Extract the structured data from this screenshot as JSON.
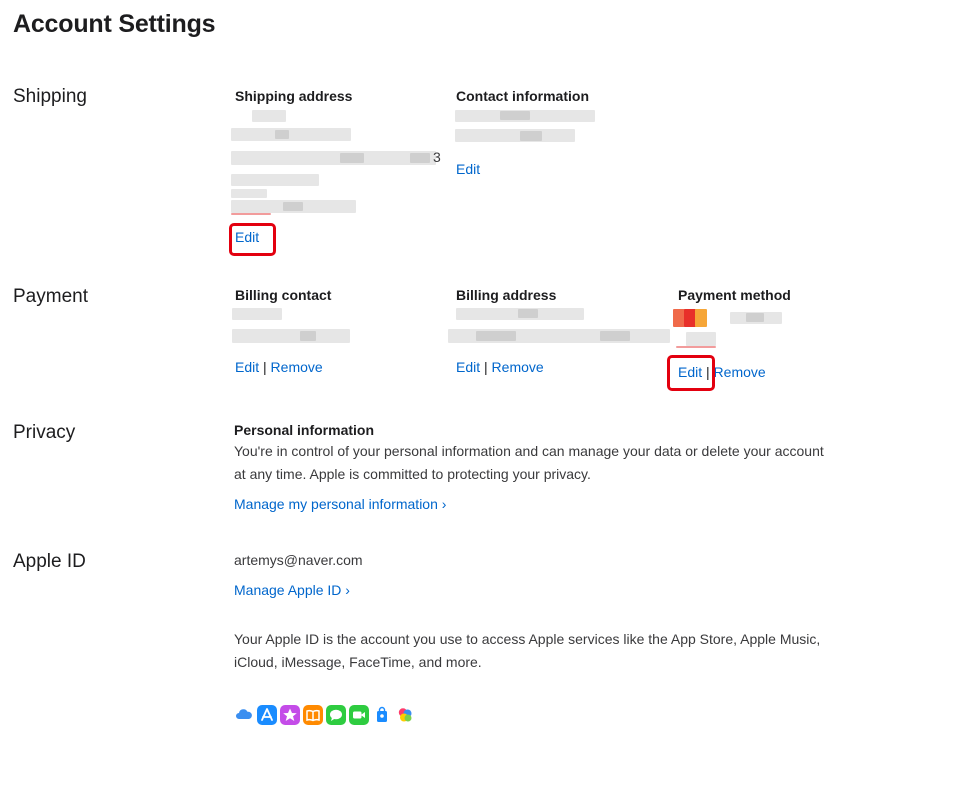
{
  "page_title": "Account Settings",
  "shipping": {
    "section": "Shipping",
    "address_title": "Shipping address",
    "address_trailing_digit": "3",
    "address_edit": "Edit",
    "contact_title": "Contact information",
    "contact_edit": "Edit"
  },
  "payment": {
    "section": "Payment",
    "billing_contact_title": "Billing contact",
    "billing_address_title": "Billing address",
    "payment_method_title": "Payment method",
    "edit": "Edit",
    "separator": "|",
    "remove": "Remove"
  },
  "privacy": {
    "section": "Privacy",
    "title": "Personal information",
    "line1": "You're in control of your personal information and can manage your data or delete your account",
    "line2": "at any time. Apple is committed to protecting your privacy.",
    "link": "Manage my personal information ›"
  },
  "apple_id": {
    "section": "Apple ID",
    "email": "artemys@naver.com",
    "link": "Manage Apple ID ›",
    "desc1": "Your Apple ID is the account you use to access Apple services like the App Store, Apple Music,",
    "desc2": "iCloud, iMessage, FaceTime, and more."
  },
  "service_icons": [
    "icloud-icon",
    "app-store-icon",
    "itunes-store-icon",
    "books-icon",
    "messages-icon",
    "facetime-icon",
    "apple-store-icon",
    "game-center-icon"
  ],
  "colors": {
    "link": "#0066cc",
    "highlight": "#e3000f",
    "text": "#1d1d1f"
  }
}
